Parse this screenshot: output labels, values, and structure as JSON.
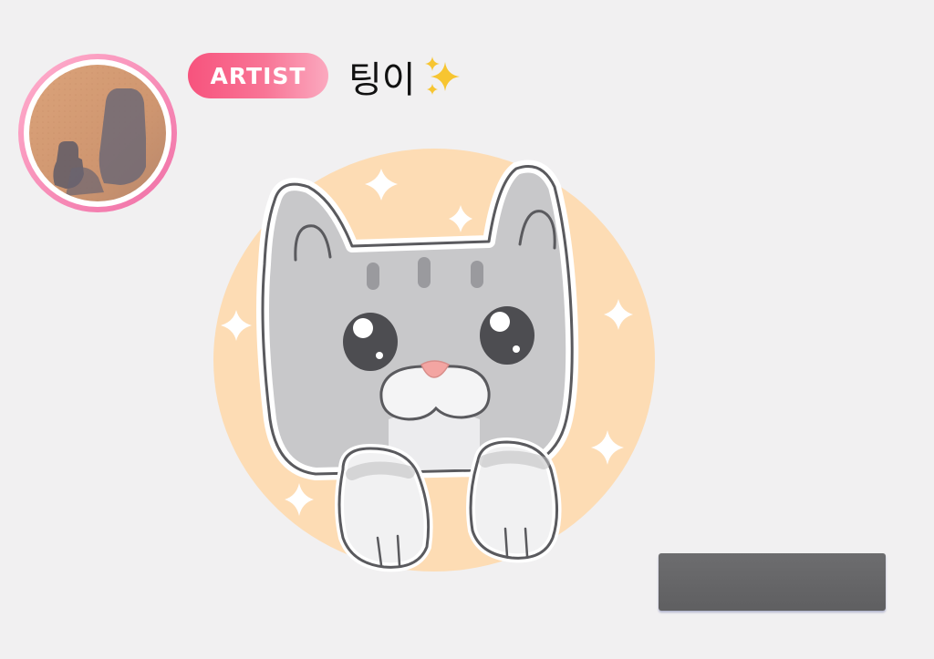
{
  "profile": {
    "badge_label": "ARTIST",
    "name": "팅이",
    "name_emoji": "sparkles-icon",
    "avatar_ring_colors": [
      "#ffb0cc",
      "#f06fa6"
    ]
  },
  "artwork": {
    "subject": "cat-illustration",
    "background_circle_color": "#fddcb4",
    "cat_color": "#c9c9cb"
  },
  "action_bar": {
    "color": "#666668"
  }
}
